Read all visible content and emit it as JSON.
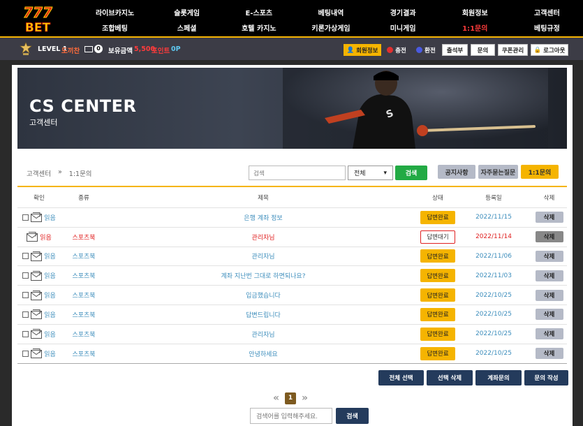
{
  "logo": {
    "top": "777",
    "bottom": "BET"
  },
  "nav": [
    {
      "label": "라이브카지노",
      "active": false
    },
    {
      "label": "슬롯게임",
      "active": false
    },
    {
      "label": "E-스포츠",
      "active": false
    },
    {
      "label": "베팅내역",
      "active": false
    },
    {
      "label": "경기결과",
      "active": false
    },
    {
      "label": "회원정보",
      "active": false
    },
    {
      "label": "고객센터",
      "active": false
    },
    {
      "label": "조합베팅",
      "active": false
    },
    {
      "label": "스페셜",
      "active": false
    },
    {
      "label": "호텔 카지노",
      "active": false
    },
    {
      "label": "키론가상게임",
      "active": false
    },
    {
      "label": "미니게임",
      "active": false
    },
    {
      "label": "1:1문의",
      "active": true
    },
    {
      "label": "베팅규정",
      "active": false
    }
  ],
  "user": {
    "level": "LEVEL 1",
    "name": "도끼찬",
    "mail_count": "0",
    "money_label": "보유금액",
    "money": "5,500",
    "point_label": "포인트",
    "point": "0P"
  },
  "userbar_buttons": {
    "member_info": "회원정보",
    "charge": "충전",
    "exchange": "환전",
    "attendance": "출석부",
    "inquiry": "문의",
    "coupon": "쿠폰관리",
    "logout": "로그아웃"
  },
  "banner": {
    "title": "CS CENTER",
    "subtitle": "고객센터"
  },
  "breadcrumb": {
    "root": "고객센터",
    "sep": "»",
    "current": "1:1문의"
  },
  "search": {
    "placeholder": "검색",
    "select_value": "전체",
    "button": "검색"
  },
  "tabs": {
    "notice": "공지사항",
    "faq": "자주묻는질문",
    "inquiry": "1:1문의"
  },
  "table": {
    "headers": [
      "확인",
      "종류",
      "제목",
      "상태",
      "등록일",
      "삭제"
    ],
    "rows": [
      {
        "read": "읽음",
        "type": "",
        "title": "은행 계좌 정보",
        "status": "답변완료",
        "date": "2022/11/15",
        "delete": "삭제",
        "unread": false,
        "checkbox": true
      },
      {
        "read": "읽음",
        "type": "스포츠북",
        "title": "관리자님",
        "status": "답변대기",
        "date": "2022/11/14",
        "delete": "삭제",
        "unread": true,
        "checkbox": false
      },
      {
        "read": "읽음",
        "type": "스포츠북",
        "title": "관리자님",
        "status": "답변완료",
        "date": "2022/11/06",
        "delete": "삭제",
        "unread": false,
        "checkbox": true
      },
      {
        "read": "읽음",
        "type": "스포츠북",
        "title": "계좌 지난번 그대로 하면되나요?",
        "status": "답변완료",
        "date": "2022/11/03",
        "delete": "삭제",
        "unread": false,
        "checkbox": true
      },
      {
        "read": "읽음",
        "type": "스포츠북",
        "title": "입금했습니다",
        "status": "답변완료",
        "date": "2022/10/25",
        "delete": "삭제",
        "unread": false,
        "checkbox": true
      },
      {
        "read": "읽음",
        "type": "스포츠북",
        "title": "답변드립니다",
        "status": "답변완료",
        "date": "2022/10/25",
        "delete": "삭제",
        "unread": false,
        "checkbox": true
      },
      {
        "read": "읽음",
        "type": "스포츠북",
        "title": "관리자님",
        "status": "답변완료",
        "date": "2022/10/25",
        "delete": "삭제",
        "unread": false,
        "checkbox": true
      },
      {
        "read": "읽음",
        "type": "스포츠북",
        "title": "안녕하세요",
        "status": "답변완료",
        "date": "2022/10/25",
        "delete": "삭제",
        "unread": false,
        "checkbox": true
      }
    ]
  },
  "actions": {
    "select_all": "전체 선택",
    "delete_selected": "선택 삭제",
    "account_inquiry": "계좌문의",
    "write_inquiry": "문의 작성"
  },
  "pager": {
    "prev": "«",
    "current": "1",
    "next": "»"
  },
  "bottom_search": {
    "placeholder": "검색어를 입력해주세요.",
    "button": "검색"
  },
  "colors": {
    "accent": "#f5b400",
    "active_nav": "#ff3b3b",
    "link": "#3c8dbc",
    "action_button": "#243b5c"
  }
}
